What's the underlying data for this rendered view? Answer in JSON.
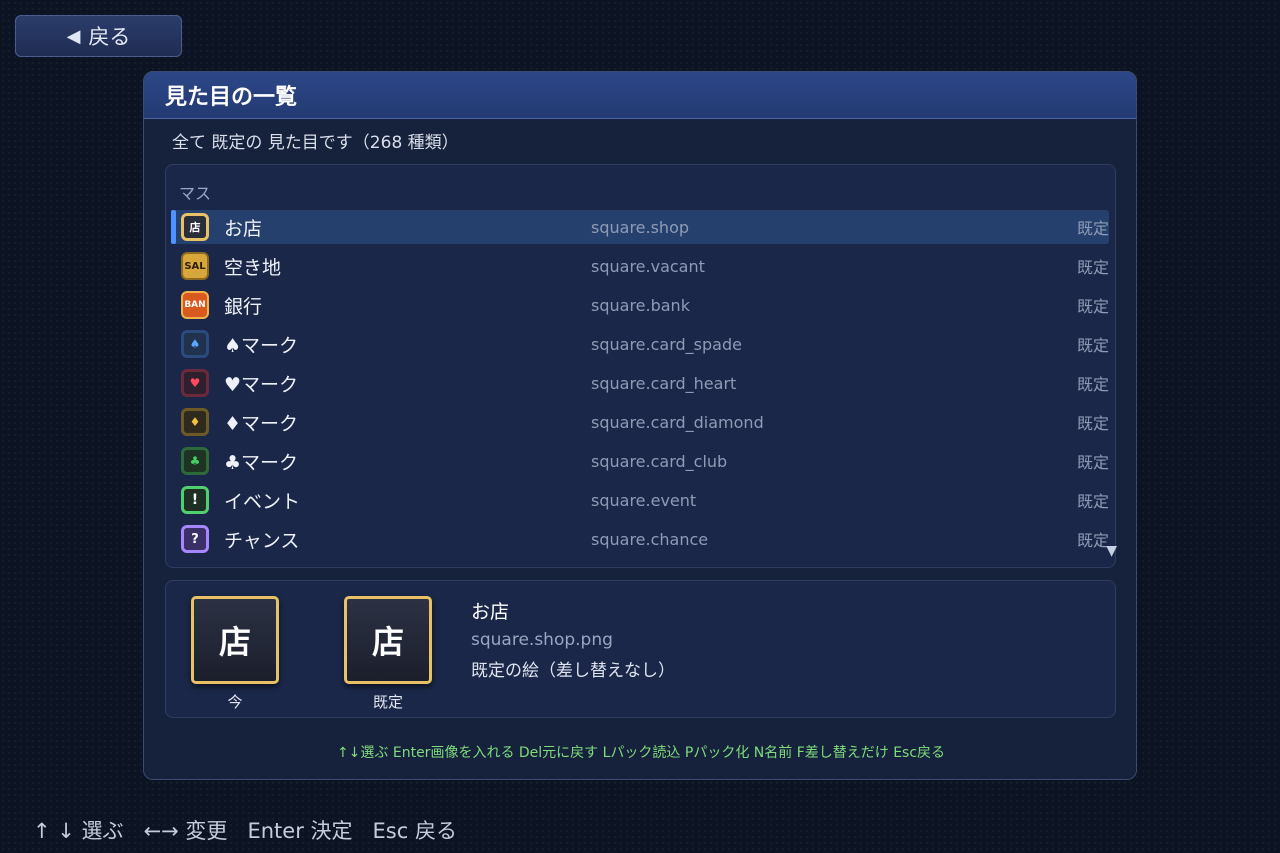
{
  "back_button": {
    "label": "戻る"
  },
  "panel": {
    "title": "見た目の一覧",
    "subtitle": "全て 既定の 見た目です（268 種類）",
    "section_label": "マス",
    "rows": [
      {
        "icon": "店",
        "icon_name": "shop-icon",
        "name": "お店",
        "id": "square.shop",
        "status": "既定"
      },
      {
        "icon": "SAL",
        "icon_name": "vacant-lot-icon",
        "name": "空き地",
        "id": "square.vacant",
        "status": "既定"
      },
      {
        "icon": "BAN",
        "icon_name": "bank-icon",
        "name": "銀行",
        "id": "square.bank",
        "status": "既定"
      },
      {
        "icon": "♠",
        "icon_name": "spade-icon",
        "name": "♠マーク",
        "id": "square.card_spade",
        "status": "既定"
      },
      {
        "icon": "♥",
        "icon_name": "heart-icon",
        "name": "♥マーク",
        "id": "square.card_heart",
        "status": "既定"
      },
      {
        "icon": "♦",
        "icon_name": "diamond-icon",
        "name": "♦マーク",
        "id": "square.card_diamond",
        "status": "既定"
      },
      {
        "icon": "♣",
        "icon_name": "club-icon",
        "name": "♣マーク",
        "id": "square.card_club",
        "status": "既定"
      },
      {
        "icon": "!",
        "icon_name": "event-icon",
        "name": "イベント",
        "id": "square.event",
        "status": "既定"
      },
      {
        "icon": "?",
        "icon_name": "chance-icon",
        "name": "チャンス",
        "id": "square.chance",
        "status": "既定"
      }
    ],
    "preview": {
      "current_glyph": "店",
      "current_label": "今",
      "default_glyph": "店",
      "default_label": "既定",
      "name": "お店",
      "file": "square.shop.png",
      "description": "既定の絵（差し替えなし）"
    },
    "help": "↑↓選ぶ Enter画像を入れる Del元に戻す Lパック読込 Pパック化 N名前 F差し替えだけ Esc戻る"
  },
  "footer": {
    "hints": "↑ ↓ 選ぶ   ←→ 変更   Enter 決定   Esc 戻る"
  },
  "colors": {
    "accent": "#4e93ff",
    "selected_row": "#26406d",
    "tile_border": "#e8c166",
    "help_text": "#7fdc7c"
  }
}
